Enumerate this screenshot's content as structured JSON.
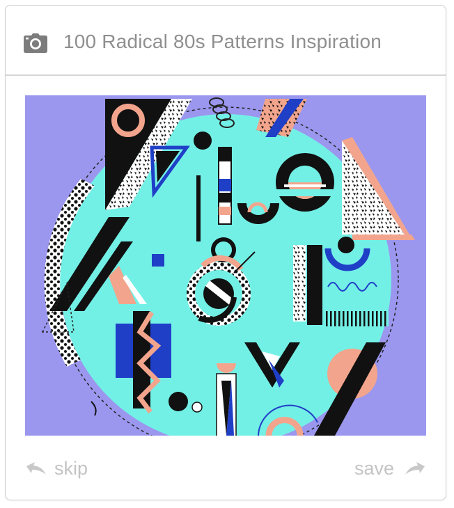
{
  "card": {
    "title": "100 Radical 80s Patterns Inspiration",
    "header_icon": "camera-icon",
    "image": {
      "subject": "80s memphis-style geometric pattern artwork",
      "background_color": "#9b97ee",
      "accent_colors": [
        "#73f0e6",
        "#1f3fc7",
        "#f2a58c",
        "#111111",
        "#ffffff"
      ]
    },
    "actions": {
      "skip_label": "skip",
      "save_label": "save",
      "skip_icon": "arrow-back-icon",
      "save_icon": "arrow-forward-icon"
    }
  }
}
